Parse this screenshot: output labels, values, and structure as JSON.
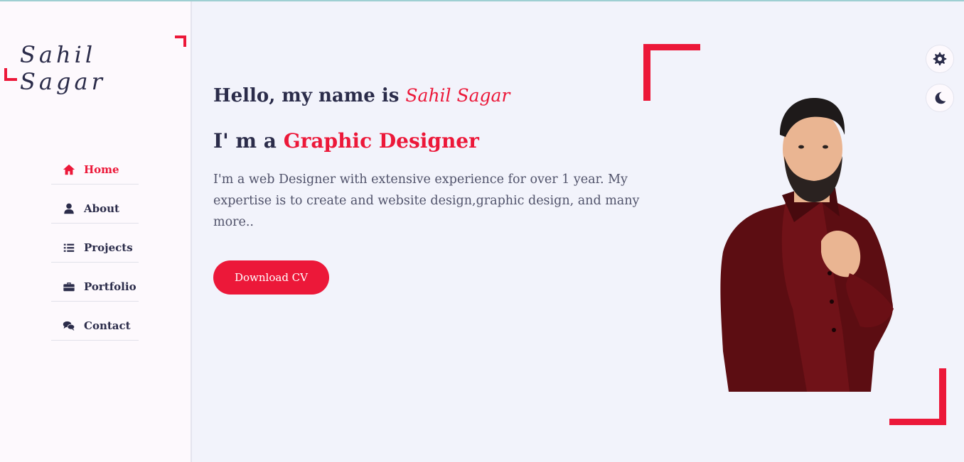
{
  "brand": {
    "logo_text": "Sahil Sagar"
  },
  "nav": {
    "items": [
      {
        "label": "Home",
        "icon": "home-icon",
        "active": true
      },
      {
        "label": "About",
        "icon": "user-icon",
        "active": false
      },
      {
        "label": "Projects",
        "icon": "list-icon",
        "active": false
      },
      {
        "label": "Portfolio",
        "icon": "briefcase-icon",
        "active": false
      },
      {
        "label": "Contact",
        "icon": "comments-icon",
        "active": false
      }
    ]
  },
  "hero": {
    "greeting": "Hello, my name is",
    "name": "Sahil Sagar",
    "role_prefix": "I' m a",
    "role": "Graphic Designer",
    "description": "I'm a web Designer with extensive experience for over 1 year. My expertise is to create and website design,graphic design, and many more..",
    "cta_label": "Download CV"
  },
  "switcher": {
    "settings_icon": "gear-icon",
    "theme_icon": "moon-icon"
  },
  "colors": {
    "accent": "#ec1839",
    "text": "#2b2c4a",
    "background": "#f2f3fb",
    "sidebar": "#fdf9fd"
  }
}
